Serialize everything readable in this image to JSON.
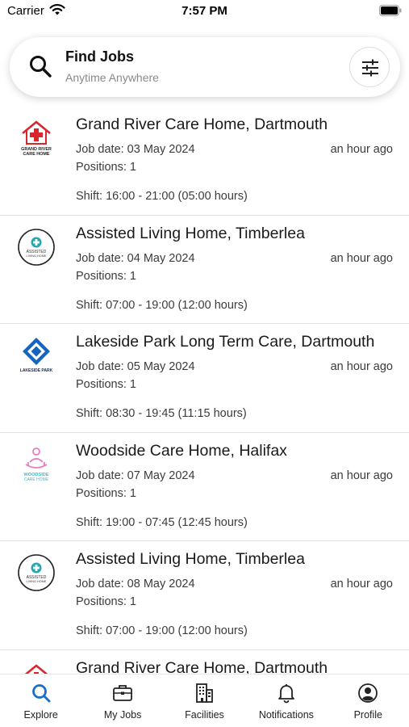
{
  "status_bar": {
    "carrier": "Carrier",
    "time": "7:57 PM"
  },
  "search": {
    "title": "Find Jobs",
    "subtitle": "Anytime Anywhere"
  },
  "jobs": [
    {
      "title": "Grand River Care Home, Dartmouth",
      "date": "Job date: 03 May 2024",
      "positions": "Positions: 1",
      "posted": "an hour ago",
      "shift": "Shift: 16:00 - 21:00 (05:00 hours)",
      "logo": "grand-river-logo",
      "logo_text": [
        "GRAND RIVER",
        "CARE HOME"
      ]
    },
    {
      "title": "Assisted Living Home, Timberlea",
      "date": "Job date: 04 May 2024",
      "positions": "Positions: 1",
      "posted": "an hour ago",
      "shift": "Shift: 07:00 - 19:00 (12:00 hours)",
      "logo": "assisted-living-logo",
      "logo_text": [
        "ASSISTED",
        "LIVING HOME"
      ]
    },
    {
      "title": "Lakeside Park Long Term Care, Dartmouth",
      "date": "Job date: 05 May 2024",
      "positions": "Positions: 1",
      "posted": "an hour ago",
      "shift": "Shift: 08:30 - 19:45 (11:15 hours)",
      "logo": "lakeside-park-logo",
      "logo_text": [
        "LAKESIDE PARK"
      ]
    },
    {
      "title": "Woodside Care Home, Halifax",
      "date": "Job date: 07 May 2024",
      "positions": "Positions: 1",
      "posted": "an hour ago",
      "shift": "Shift: 19:00 - 07:45 (12:45 hours)",
      "logo": "woodside-logo",
      "logo_text": [
        "WOODSIDE",
        "CARE HOME"
      ]
    },
    {
      "title": "Assisted Living Home, Timberlea",
      "date": "Job date: 08 May 2024",
      "positions": "Positions: 1",
      "posted": "an hour ago",
      "shift": "Shift: 07:00 - 19:00 (12:00 hours)",
      "logo": "assisted-living-logo",
      "logo_text": [
        "ASSISTED",
        "LIVING HOME"
      ]
    },
    {
      "title": "Grand River Care Home, Dartmouth",
      "logo": "grand-river-logo"
    }
  ],
  "tabs": [
    {
      "label": "Explore",
      "icon": "search-icon",
      "active": true
    },
    {
      "label": "My Jobs",
      "icon": "briefcase-icon",
      "active": false
    },
    {
      "label": "Facilities",
      "icon": "building-icon",
      "active": false
    },
    {
      "label": "Notifications",
      "icon": "bell-icon",
      "active": false
    },
    {
      "label": "Profile",
      "icon": "profile-icon",
      "active": false
    }
  ],
  "colors": {
    "accent": "#1a6fc9",
    "grand_river_red": "#d9262c",
    "lakeside_blue": "#1565c0",
    "woodside_pink": "#e87dc2",
    "woodside_teal": "#4fb6c9",
    "assisted_teal": "#22a7b5"
  }
}
